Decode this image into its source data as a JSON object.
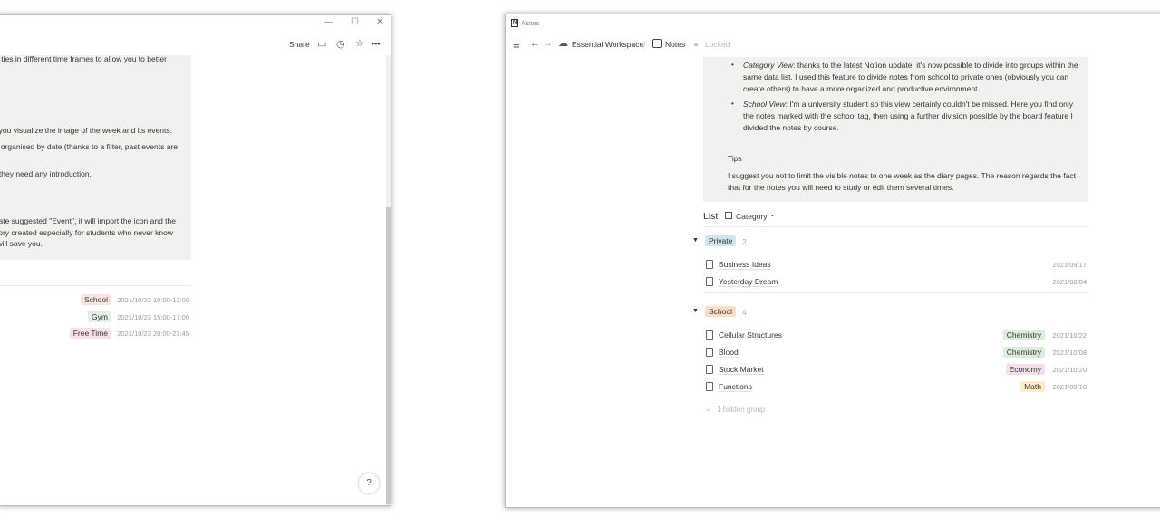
{
  "left_window": {
    "controls": {
      "minimize": "—",
      "maximize": "☐",
      "close": "✕"
    },
    "topbar": {
      "share": "Share",
      "comment_icon": "comment-icon",
      "history_icon": "clock-icon",
      "favorite_icon": "star-icon",
      "more": "•••"
    },
    "callout_lines": [
      "ties in different time frames to allow you to better",
      "s you visualize the image of the week and its events.",
      "s organised by date (thanks to a filter, past events are",
      "they need any introduction.",
      "ate suggested \"Event\", it will import the icon and the",
      "ory created especially for students who never know",
      "will save you."
    ],
    "events": [
      {
        "tag": "School",
        "date": "2021/10/23 10:00-12:00",
        "color": "#fbe4e0"
      },
      {
        "tag": "Gym",
        "date": "2021/10/23 15:00-17:00",
        "color": "#e1efe5"
      },
      {
        "tag": "Free Time",
        "date": "2021/10/23 20:00-23:45",
        "color": "#f6e2ea"
      }
    ],
    "help": "?"
  },
  "right_window": {
    "title": "Notes",
    "breadcrumb": {
      "workspace": "Essential Workspace",
      "sep": "/",
      "page": "Notes",
      "locked": "Locked"
    },
    "bullets": [
      {
        "label": "Category View",
        "text": ": thanks to the latest Notion update, it's now possible to divide into groups within the",
        "more": [
          "same data list. I used this feature to divide notes from school to private ones (obviously you can",
          "create others) to have a more organized and productive environment."
        ]
      },
      {
        "label": "School View",
        "text": ": I'm a university student so this view certainly couldn't be missed. Here you find only",
        "more": [
          "the notes marked with the school tag, then using a further division possible by the board feature I",
          "divided the notes by course."
        ]
      }
    ],
    "tips": {
      "heading": "Tips",
      "lines": [
        "I suggest you not to limit the visible notes to one week as the diary pages. The reason regards the fact",
        "that for the notes you will need to study or edit them several times."
      ]
    },
    "list": {
      "title": "List",
      "view": "Category",
      "groups": [
        {
          "name": "Private",
          "count": "2",
          "color": "#d3e5ef",
          "items": [
            {
              "title": "Business Ideas",
              "date": "2021/09/17"
            },
            {
              "title": "Yesterday Dream",
              "date": "2021/08/04"
            }
          ]
        },
        {
          "name": "School",
          "count": "4",
          "color": "#fadec9",
          "items": [
            {
              "title": "Cellular Structures",
              "tag": "Chemistry",
              "tag_color": "#dbeddb",
              "date": "2021/10/22"
            },
            {
              "title": "Blood",
              "tag": "Chemistry",
              "tag_color": "#dbeddb",
              "date": "2021/10/08"
            },
            {
              "title": "Stock Market",
              "tag": "Economy",
              "tag_color": "#f5e0e9",
              "date": "2021/10/20"
            },
            {
              "title": "Functions",
              "tag": "Math",
              "tag_color": "#fdecc8",
              "date": "2021/08/10"
            }
          ]
        }
      ],
      "hidden": "1 hidden group"
    }
  }
}
